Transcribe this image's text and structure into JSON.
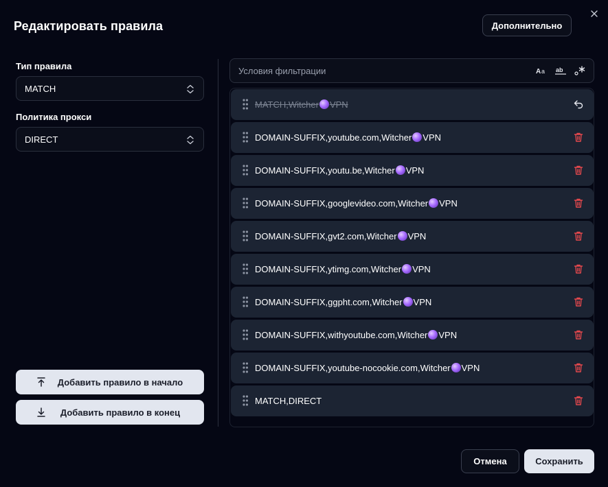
{
  "dialog": {
    "title": "Редактировать правила",
    "advanced_label": "Дополнительно"
  },
  "rule_type": {
    "label": "Тип правила",
    "value": "MATCH"
  },
  "proxy_policy": {
    "label": "Политика прокси",
    "value": "DIRECT"
  },
  "actions": {
    "add_start": "Добавить правило в начало",
    "add_end": "Добавить правило в конец"
  },
  "filter": {
    "placeholder": "Условия фильтрации",
    "options": [
      "match-case-icon",
      "match-whole-word-icon",
      "regex-icon"
    ]
  },
  "rules": [
    {
      "pre": "MATCH,Witcher",
      "post": "VPN",
      "state": "deleted",
      "action": "undo-icon"
    },
    {
      "pre": "DOMAIN-SUFFIX,youtube.com,Witcher",
      "post": "VPN",
      "state": "active",
      "action": "trash-icon"
    },
    {
      "pre": "DOMAIN-SUFFIX,youtu.be,Witcher",
      "post": "VPN",
      "state": "active",
      "action": "trash-icon"
    },
    {
      "pre": "DOMAIN-SUFFIX,googlevideo.com,Witcher",
      "post": "VPN",
      "state": "active",
      "action": "trash-icon"
    },
    {
      "pre": "DOMAIN-SUFFIX,gvt2.com,Witcher",
      "post": "VPN",
      "state": "active",
      "action": "trash-icon"
    },
    {
      "pre": "DOMAIN-SUFFIX,ytimg.com,Witcher",
      "post": "VPN",
      "state": "active",
      "action": "trash-icon"
    },
    {
      "pre": "DOMAIN-SUFFIX,ggpht.com,Witcher",
      "post": "VPN",
      "state": "active",
      "action": "trash-icon"
    },
    {
      "pre": "DOMAIN-SUFFIX,withyoutube.com,Witcher",
      "post": "VPN",
      "state": "active",
      "action": "trash-icon"
    },
    {
      "pre": "DOMAIN-SUFFIX,youtube-nocookie.com,Witcher",
      "post": "VPN",
      "state": "active",
      "action": "trash-icon"
    },
    {
      "pre": "MATCH,DIRECT",
      "post": "",
      "state": "active",
      "action": "trash-icon"
    }
  ],
  "footer": {
    "cancel": "Отмена",
    "save": "Сохранить"
  },
  "colors": {
    "background": "#050714",
    "row": "#1c2433",
    "delete": "#e5484d",
    "button_light": "#e2e6ef"
  }
}
